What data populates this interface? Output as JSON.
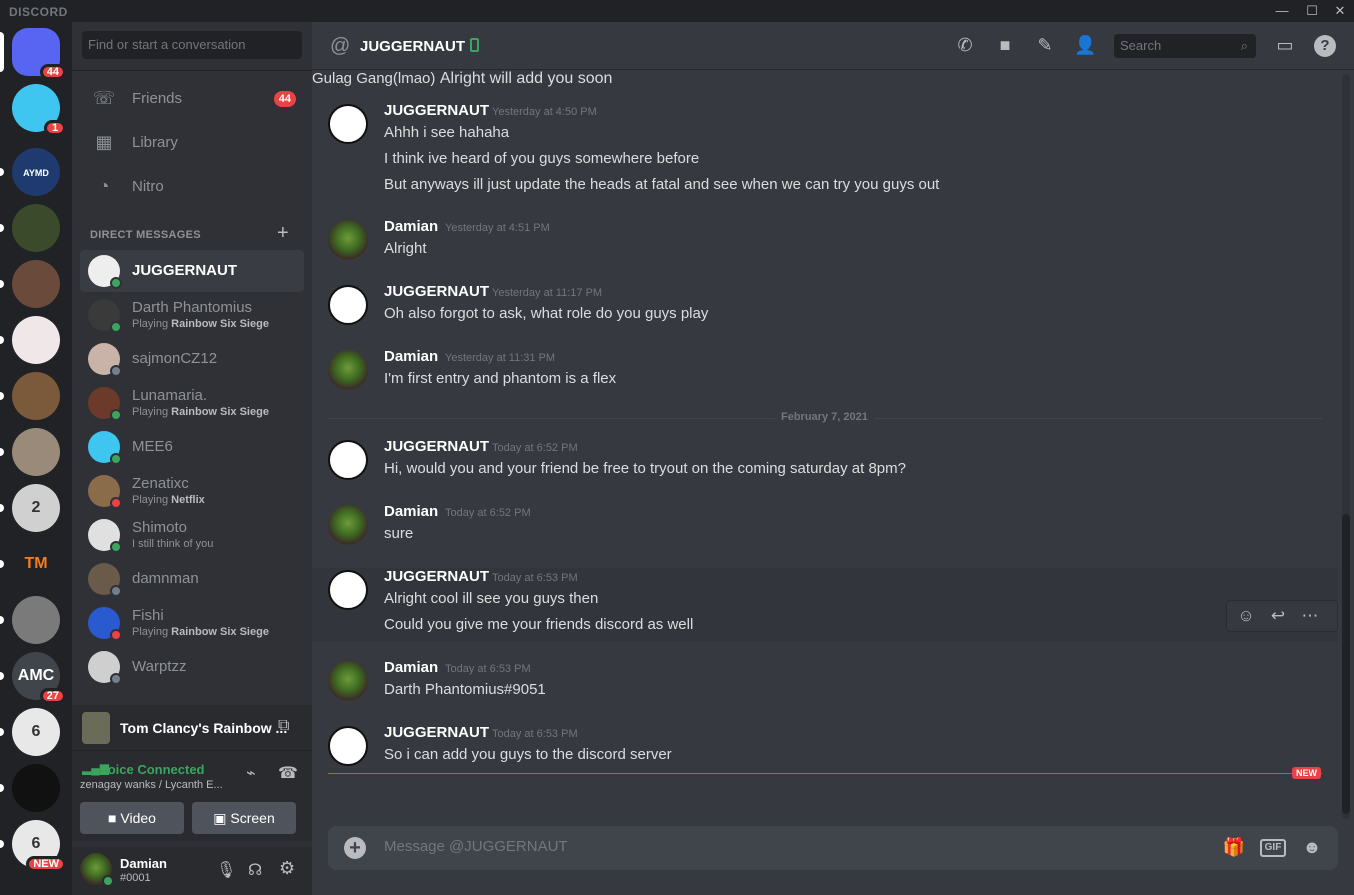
{
  "app": {
    "brand": "DISCORD"
  },
  "window": {
    "minimize": "—",
    "maximize": "☐",
    "close": "✕"
  },
  "guilds": [
    {
      "label": "",
      "badge": "44",
      "color": "#5865f2",
      "icon": "discord-home-icon"
    },
    {
      "label": "",
      "badge": "1",
      "color": "#3ec6f0",
      "icon": "mee6-server-icon"
    },
    {
      "label": "AYMD",
      "badge": "",
      "color": "#1e3a6e",
      "icon": "aymd-server-icon"
    },
    {
      "label": "",
      "badge": "",
      "color": "#3b4a2a",
      "icon": "voice-server-icon"
    },
    {
      "label": "",
      "badge": "",
      "color": "#6a4a3a",
      "icon": "server-icon"
    },
    {
      "label": "",
      "badge": "",
      "color": "#f0e8e8",
      "icon": "cat-server-icon"
    },
    {
      "label": "",
      "badge": "",
      "color": "#7a5a3a",
      "icon": "server-icon"
    },
    {
      "label": "",
      "badge": "",
      "color": "#9a8a7a",
      "icon": "server-icon"
    },
    {
      "label": "2",
      "badge": "",
      "color": "#d0d0d0",
      "icon": "server-icon"
    },
    {
      "label": "TM",
      "badge": "",
      "color": "#202225",
      "icon": "tm-server-icon"
    },
    {
      "label": "",
      "badge": "",
      "color": "#7a7a7a",
      "icon": "server-icon"
    },
    {
      "label": "AMC",
      "badge": "27",
      "color": "#40444b",
      "icon": "amc-server-icon"
    },
    {
      "label": "6",
      "badge": "",
      "color": "#e8e8e8",
      "icon": "rainbow-six-server-icon"
    },
    {
      "label": "",
      "badge": "",
      "color": "#111111",
      "icon": "server-icon"
    },
    {
      "label": "6",
      "badge": "NEW",
      "color": "#e8e8e8",
      "icon": "rainbow-six-server-icon"
    }
  ],
  "sidebar": {
    "search_placeholder": "Find or start a conversation",
    "nav": [
      {
        "label": "Friends",
        "badge": "44",
        "icon": "friends-icon"
      },
      {
        "label": "Library",
        "badge": "",
        "icon": "library-icon"
      },
      {
        "label": "Nitro",
        "badge": "",
        "icon": "nitro-icon"
      }
    ],
    "dm_header": "DIRECT MESSAGES",
    "dms": [
      {
        "name": "JUGGERNAUT",
        "activity_prefix": "",
        "activity_bold": "",
        "status": "#3ba55d",
        "active": true
      },
      {
        "name": "Darth Phantomius",
        "activity_prefix": "Playing ",
        "activity_bold": "Rainbow Six Siege",
        "status": "#3ba55d",
        "active": false
      },
      {
        "name": "sajmonCZ12",
        "activity_prefix": "",
        "activity_bold": "",
        "status": "#747f8d",
        "active": false
      },
      {
        "name": "Lunamaria.",
        "activity_prefix": "Playing ",
        "activity_bold": "Rainbow Six Siege",
        "status": "#3ba55d",
        "active": false
      },
      {
        "name": "MEE6",
        "activity_prefix": "",
        "activity_bold": "",
        "status": "#3ba55d",
        "active": false
      },
      {
        "name": "Zenatixc",
        "activity_prefix": "Playing ",
        "activity_bold": "Netflix",
        "status": "#ed4245",
        "active": false
      },
      {
        "name": "Shimoto",
        "activity_prefix": "I still think of you",
        "activity_bold": "",
        "status": "#3ba55d",
        "active": false
      },
      {
        "name": "damnman",
        "activity_prefix": "",
        "activity_bold": "",
        "status": "#747f8d",
        "active": false
      },
      {
        "name": "Fishi",
        "activity_prefix": "Playing ",
        "activity_bold": "Rainbow Six Siege",
        "status": "#ed4245",
        "active": false
      },
      {
        "name": "Warptzz",
        "activity_prefix": "",
        "activity_bold": "",
        "status": "#747f8d",
        "active": false
      }
    ],
    "activity": {
      "game": "Tom Clancy's Rainbow ..."
    },
    "voice": {
      "status": "Voice Connected",
      "channel": "zenagay wanks / Lycanth E...",
      "video_label": "Video",
      "screen_label": "Screen"
    },
    "user": {
      "name": "Damian",
      "tag": "#0001"
    }
  },
  "header": {
    "title": "JUGGERNAUT",
    "search_placeholder": "Search"
  },
  "messages": {
    "partial_line": "Gulag Gang(lmao)",
    "date_divider": "February 7, 2021",
    "new_label": "NEW",
    "groups": [
      {
        "author": "JUGGERNAUT",
        "time": "Yesterday at 4:50 PM",
        "avatar": "jug",
        "lines": [
          "Ahhh i see hahaha",
          "I think ive heard of you guys somewhere before",
          "But anyways ill just update the heads at fatal and see when we can try you guys out"
        ]
      },
      {
        "author": "Damian",
        "time": "Yesterday at 4:51 PM",
        "avatar": "dam",
        "lines": [
          "Alright"
        ]
      },
      {
        "author": "JUGGERNAUT",
        "time": "Yesterday at 11:17 PM",
        "avatar": "jug",
        "lines": [
          "Oh also forgot to ask, what role do you guys play"
        ]
      },
      {
        "author": "Damian",
        "time": "Yesterday at 11:31 PM",
        "avatar": "dam",
        "lines": [
          "I'm first entry and phantom is a flex"
        ]
      },
      {
        "author": "JUGGERNAUT",
        "time": "Today at 6:52 PM",
        "avatar": "jug",
        "lines": [
          "Hi, would you and your friend be free to tryout on the coming saturday at 8pm?"
        ]
      },
      {
        "author": "Damian",
        "time": "Today at 6:52 PM",
        "avatar": "dam",
        "lines": [
          "sure"
        ]
      },
      {
        "author": "JUGGERNAUT",
        "time": "Today at 6:53 PM",
        "avatar": "jug",
        "lines": [
          "Alright cool ill see you guys then",
          "Could you give me your friends discord as well"
        ]
      },
      {
        "author": "Damian",
        "time": "Today at 6:53 PM",
        "avatar": "dam",
        "lines": [
          "Darth Phantomius#9051"
        ]
      },
      {
        "author": "JUGGERNAUT",
        "time": "Today at 6:53 PM",
        "avatar": "jug",
        "lines": [
          "So i can add you guys to the discord server"
        ]
      }
    ],
    "after_new": "Alright will add you soon"
  },
  "composer": {
    "placeholder": "Message @JUGGERNAUT",
    "gif_label": "GIF"
  }
}
